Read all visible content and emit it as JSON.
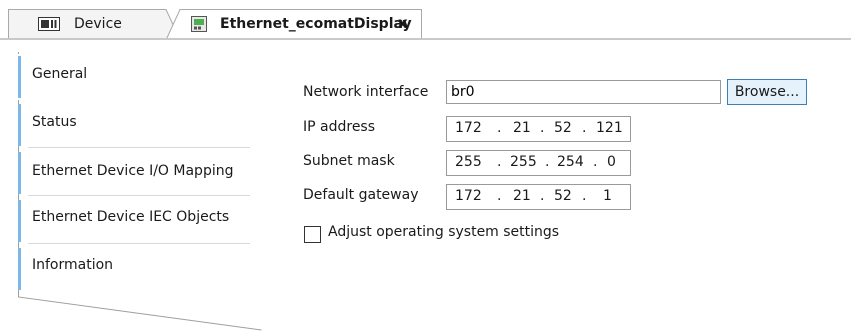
{
  "tabs": [
    {
      "label": "Device",
      "icon": "device-icon"
    },
    {
      "label": "Ethernet_ecomatDisplay",
      "icon": "ethernet-module-icon",
      "close": "x"
    }
  ],
  "sidebar": {
    "items": [
      {
        "label": "General",
        "selected": true
      },
      {
        "label": "Status"
      },
      {
        "label": "Ethernet Device I/O Mapping"
      },
      {
        "label": "Ethernet Device IEC Objects"
      },
      {
        "label": "Information"
      }
    ],
    "accent_color": "#7bb7e8"
  },
  "form": {
    "network_interface": {
      "label": "Network interface",
      "value": "br0"
    },
    "browse_label": "Browse...",
    "ip_address": {
      "label": "IP address",
      "octets": [
        "172",
        "21",
        "52",
        "121"
      ]
    },
    "subnet_mask": {
      "label": "Subnet mask",
      "octets": [
        "255",
        "255",
        "254",
        "0"
      ]
    },
    "default_gateway": {
      "label": "Default gateway",
      "octets": [
        "172",
        "21",
        "52",
        "1"
      ]
    },
    "ip_separator": ".",
    "adjust_os": {
      "label": "Adjust operating system settings",
      "checked": false
    }
  }
}
